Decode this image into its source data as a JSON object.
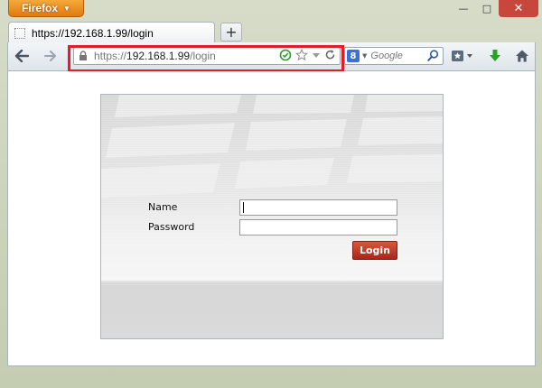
{
  "window": {
    "app_button_label": "Firefox",
    "controls": {
      "minimize": "—",
      "maximize": "□",
      "close": "✕"
    }
  },
  "tab": {
    "title": "https://192.168.1.99/login"
  },
  "new_tab_label": "+",
  "urlbar": {
    "scheme": "https://",
    "host": "192.168.1.99",
    "path": "/login",
    "icons": [
      "check-circle-icon",
      "star-icon",
      "dropdown-triangle-icon",
      "reload-icon"
    ]
  },
  "searchbar": {
    "engine_badge": "8",
    "placeholder": "Google"
  },
  "login_form": {
    "name_label": "Name",
    "password_label": "Password",
    "name_value": "",
    "password_value": "",
    "login_button": "Login"
  },
  "colors": {
    "highlight": "#e11d2a",
    "firefox_orange": "#e88b1e",
    "login_button": "#c0392b",
    "close_button": "#c8473c"
  }
}
